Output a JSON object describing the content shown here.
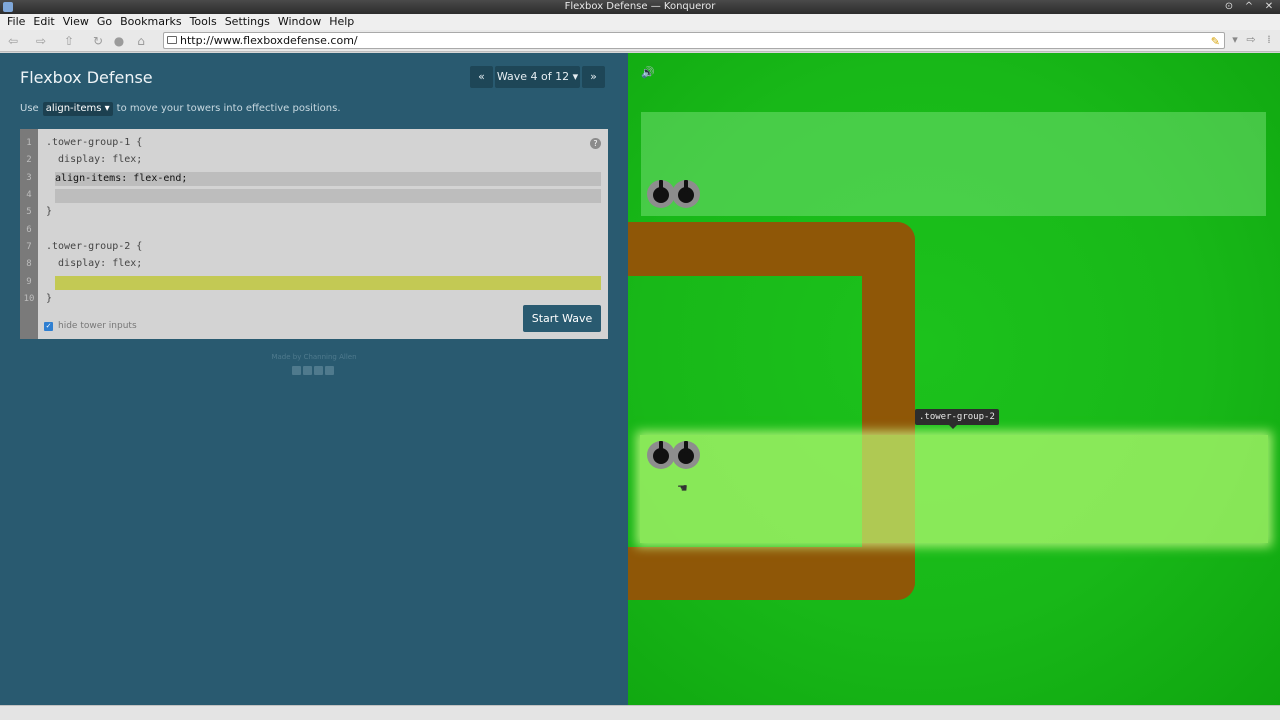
{
  "window": {
    "title": "Flexbox Defense — Konqueror",
    "controls": [
      "⊙",
      "^",
      "✕"
    ]
  },
  "menu": [
    "File",
    "Edit",
    "View",
    "Go",
    "Bookmarks",
    "Tools",
    "Settings",
    "Window",
    "Help"
  ],
  "toolbar": {
    "url": "http://www.flexboxdefense.com/",
    "icons": [
      "back-icon",
      "forward-icon",
      "up-icon",
      "reload-icon",
      "stop-icon",
      "home-icon"
    ]
  },
  "game": {
    "title": "Flexbox Defense",
    "wave": {
      "prev": "«",
      "label": "Wave 4 of 12 ▾",
      "next": "»"
    },
    "instruction": {
      "before": "Use",
      "property": "align-items ▾",
      "after": "to move your towers into effective positions."
    },
    "editor": {
      "line_numbers": [
        "1",
        "2",
        "3",
        "4",
        "5",
        "6",
        "7",
        "8",
        "9",
        "10"
      ],
      "lines": [
        ".tower-group-1 {",
        "  display: flex;",
        "}",
        ".tower-group-2 {",
        "  display: flex;",
        "}"
      ],
      "input_1": "align-items: flex-end;",
      "input_2": "",
      "input_3": ""
    },
    "start_wave": "Start Wave",
    "hide_inputs_label": "hide tower inputs",
    "hide_inputs_checked": true,
    "credit": "Made by Channing Allen",
    "board_label": ".tower-group-2"
  },
  "colors": {
    "panel": "#295a70",
    "path": "#8f5707",
    "grass": "#18b818",
    "input_highlight": "#c3c954"
  }
}
